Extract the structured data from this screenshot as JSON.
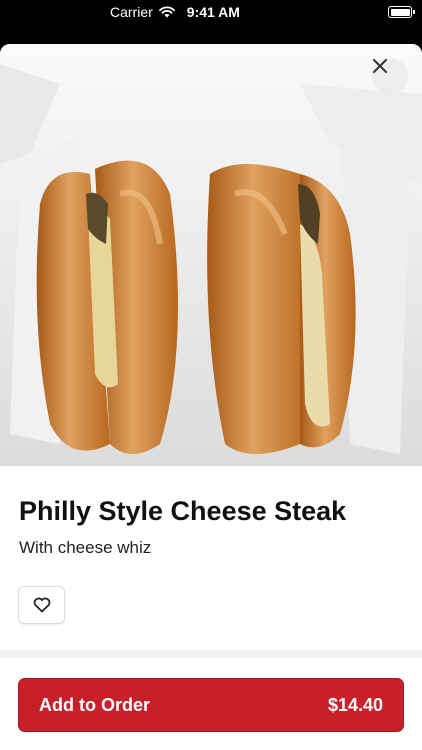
{
  "status_bar": {
    "carrier": "Carrier",
    "time": "9:41 AM",
    "wifi_icon": "wifi-icon",
    "battery_icon": "battery-icon"
  },
  "item": {
    "title": "Philly Style Cheese Steak",
    "description": "With cheese whiz",
    "image_alt": "Two cheese steak sandwiches in a styrofoam container"
  },
  "actions": {
    "close_icon": "close-icon",
    "favorite_icon": "heart-icon",
    "add_label": "Add to Order",
    "price": "$14.40"
  },
  "colors": {
    "accent": "#c8202a",
    "text": "#111111"
  }
}
